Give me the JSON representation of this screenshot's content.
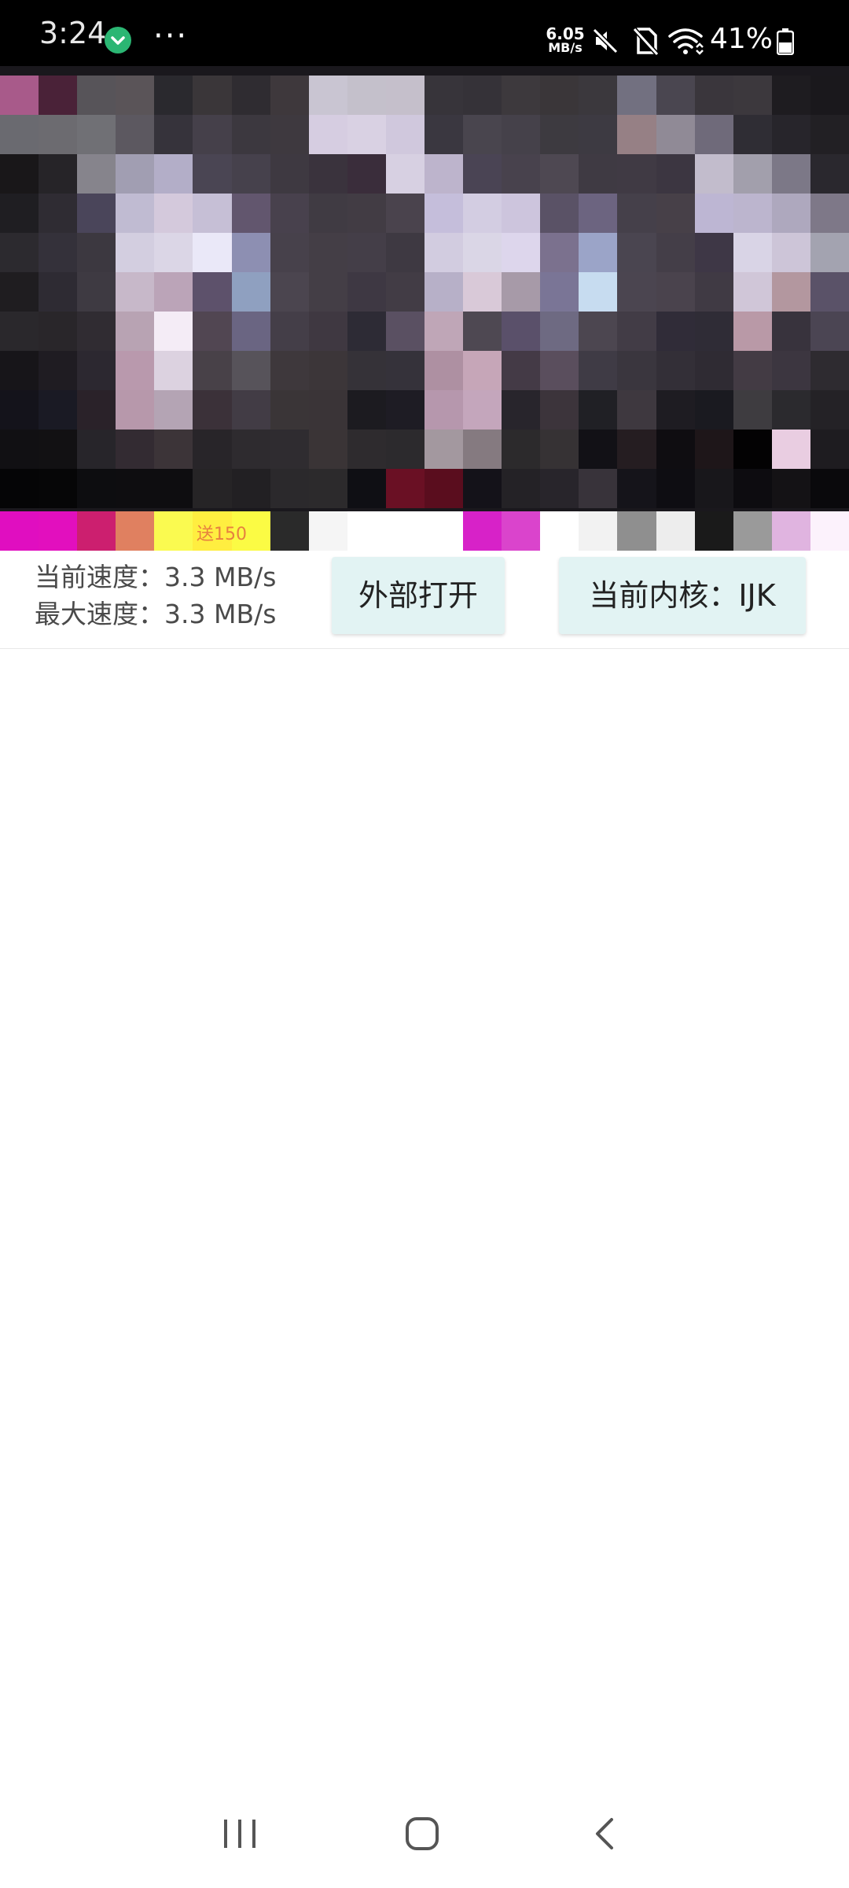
{
  "status_bar": {
    "time": "3:24",
    "net_speed_value": "6.05",
    "net_speed_unit": "MB/s",
    "battery": "41%",
    "icons": [
      "vpn-check-icon",
      "more-dots-icon",
      "mute-icon",
      "no-sim-icon",
      "wifi-icon",
      "battery-icon"
    ]
  },
  "video": {
    "overlay_text": "送150",
    "pixel_colors": [
      [
        "#a85a8a",
        "#4a2238",
        "#575459",
        "#5a5458",
        "#2a292e",
        "#3a3639",
        "#2f2c31",
        "#3e383c",
        "#c9c5d2",
        "#c4c0cb",
        "#c5bfcb",
        "#37343a",
        "#353238",
        "#3d393d",
        "#3a3639",
        "#3b383d",
        "#727080",
        "#4a4650",
        "#3a363c",
        "#3c383d",
        "#1e1c20",
        "#1a181c"
      ],
      [
        "#6a6a70",
        "#6c6b70",
        "#707075",
        "#5c5860",
        "#36333b",
        "#45404a",
        "#3c383f",
        "#3e393f",
        "#d6cde1",
        "#d9d1e3",
        "#d0c8dd",
        "#3a3740",
        "#49454e",
        "#45414a",
        "#3d3a40",
        "#3d3a42",
        "#968085",
        "#908a96",
        "#6f6a7a",
        "#2f2d34",
        "#27252b",
        "#222024"
      ],
      [
        "#191719",
        "#262428",
        "#86848c",
        "#a19eb2",
        "#b3aec8",
        "#4a4553",
        "#46414c",
        "#3e3941",
        "#3a333d",
        "#3a2d3b",
        "#d7d0e2",
        "#bdb4cc",
        "#4a4454",
        "#48424d",
        "#4e4852",
        "#3f3a43",
        "#403a44",
        "#3c3641",
        "#c2bccc",
        "#a29fac",
        "#7c7887",
        "#2a282e"
      ],
      [
        "#1f1e22",
        "#2f2c33",
        "#4a455a",
        "#c0bbd2",
        "#d4c9dc",
        "#c6bfd6",
        "#62566e",
        "#48414d",
        "#403b43",
        "#423c44",
        "#4a434d",
        "#c5bedb",
        "#d3cde2",
        "#cdc5dd",
        "#5a5266",
        "#6c6480",
        "#45404a",
        "#474048",
        "#bdb6d3",
        "#bcb5ce",
        "#aea8be",
        "#7e7888"
      ],
      [
        "#2c2a2f",
        "#34313a",
        "#3c3840",
        "#d3cee0",
        "#dbd6e6",
        "#eae8f8",
        "#8d8fb2",
        "#47414b",
        "#443e46",
        "#443e48",
        "#3e3942",
        "#d2cce0",
        "#dad6e6",
        "#ddd6ec",
        "#7b718e",
        "#9ba4c8",
        "#4a4550",
        "#443e48",
        "#3e3746",
        "#d9d4e6",
        "#cdc5d8",
        "#a3a3b0"
      ],
      [
        "#1f1d20",
        "#2e2b33",
        "#3e3a42",
        "#c7b8c9",
        "#bba4b8",
        "#5d516b",
        "#8fa0c0",
        "#4b454f",
        "#443e46",
        "#3e3843",
        "#423c45",
        "#b7b0c8",
        "#d9c9d8",
        "#a79aa8",
        "#7a7596",
        "#c7dcf0",
        "#4b4550",
        "#4a434d",
        "#403a44",
        "#d0c6d8",
        "#b3979f",
        "#5a5268"
      ],
      [
        "#2a282c",
        "#29262a",
        "#302c32",
        "#b8a3b3",
        "#f4ecf6",
        "#514652",
        "#6a6582",
        "#443e48",
        "#3f3841",
        "#2d2b35",
        "#5a5062",
        "#bfa6b7",
        "#4e4852",
        "#5a506a",
        "#6e6a82",
        "#4c4650",
        "#423c46",
        "#302c38",
        "#2f2c36",
        "#b999a7",
        "#38333d",
        "#4b4553"
      ],
      [
        "#171519",
        "#1f1c22",
        "#2c2830",
        "#b999ad",
        "#dcd2e0",
        "#484148",
        "#57535a",
        "#3e383c",
        "#3c3639",
        "#353238",
        "#35323a",
        "#ae90a2",
        "#c6a6b8",
        "#443a46",
        "#5a4e5d",
        "#3f3b45",
        "#3a363e",
        "#332f37",
        "#2f2b33",
        "#433b44",
        "#3c3640",
        "#2e2b30"
      ],
      [
        "#14131b",
        "#1a1a24",
        "#2a2229",
        "#b798ab",
        "#b4a4b4",
        "#3b3139",
        "#423c45",
        "#3a3537",
        "#3a3437",
        "#1c1b20",
        "#1e1c24",
        "#b697ad",
        "#c4a6bc",
        "#28252c",
        "#3c343b",
        "#202025",
        "#3e383f",
        "#1e1c22",
        "#1a1a20",
        "#3e3c40",
        "#2b2a2e",
        "#242226"
      ],
      [
        "#111013",
        "#121113",
        "#27252a",
        "#332b32",
        "#3c3438",
        "#282529",
        "#2e2b2f",
        "#2f2c30",
        "#3a3436",
        "#2e2b2e",
        "#2c2a2d",
        "#a3989f",
        "#857a80",
        "#2c2a2c",
        "#363234",
        "#121116",
        "#251d21",
        "#0f0d11",
        "#1e1619",
        "#030203",
        "#e9cde1",
        "#1e1c20"
      ],
      [
        "#050506",
        "#060607",
        "#0d0d10",
        "#0e0d10",
        "#0e0d10",
        "#262426",
        "#222023",
        "#2b292c",
        "#2c2a2c",
        "#0f0f14",
        "#6a1024",
        "#5a0d1e",
        "#141219",
        "#242226",
        "#28252b",
        "#38333a",
        "#15141a",
        "#0e0d12",
        "#18171b",
        "#0d0c10",
        "#141215",
        "#0a090c"
      ]
    ],
    "strip_colors": [
      "#e00ec0",
      "#e20fbe",
      "#cc1f6f",
      "#e08060",
      "#fafa50",
      "#ffee40",
      "#fbfb44",
      "#2a2a2a",
      "#f5f5f5",
      "#ffffff",
      "#ffffff",
      "#ffffff",
      "#d722c8",
      "#da44cc",
      "#ffffff",
      "#f2f2f2",
      "#8f8f8f",
      "#ededed",
      "#1a1a1a",
      "#9a9a9a",
      "#e0b4e0",
      "#fcf2fc"
    ]
  },
  "controls": {
    "current_speed_label": "当前速度：",
    "current_speed_value": "3.3 MB/s",
    "max_speed_label": "最大速度：",
    "max_speed_value": "3.3 MB/s",
    "open_external_label": "外部打开",
    "kernel_label": "当前内核：IJK"
  },
  "nav_bar": {
    "icons": [
      "recent-apps-icon",
      "home-icon",
      "back-icon"
    ]
  }
}
